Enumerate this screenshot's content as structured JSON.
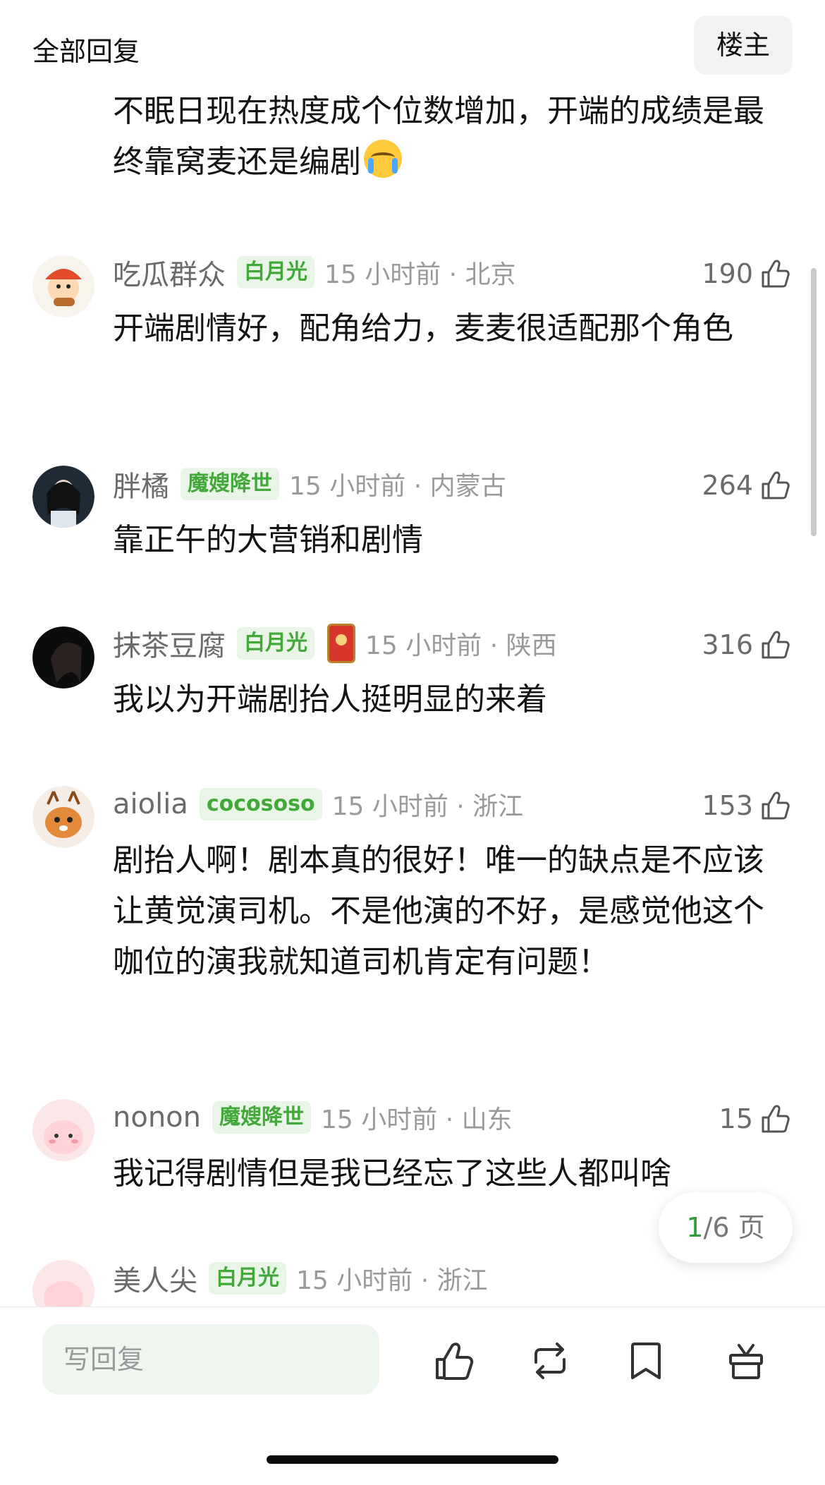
{
  "header": {
    "title": "全部回复",
    "owner_button": "楼主"
  },
  "first_comment_text_part": "不眠日现在热度成个位数增加，开端的成绩是最终靠窝麦还是编剧",
  "comments": [
    {
      "username": "吃瓜群众",
      "badge": "白月光",
      "time": "15 小时前 · 北京",
      "likes": "190",
      "text": "开端剧情好，配角给力，麦麦很适配那个角色"
    },
    {
      "username": "胖橘",
      "badge": "魔嫂降世",
      "time": "15 小时前 · 内蒙古",
      "likes": "264",
      "text": "靠正午的大营销和剧情"
    },
    {
      "username": "抹茶豆腐",
      "badge": "白月光",
      "time": "15 小时前 · 陕西",
      "likes": "316",
      "text": "我以为开端剧抬人挺明显的来着"
    },
    {
      "username": "aiolia",
      "badge": "cocososo",
      "time": "15 小时前 · 浙江",
      "likes": "153",
      "text": "剧抬人啊！剧本真的很好！唯一的缺点是不应该让黄觉演司机。不是他演的不好，是感觉他这个咖位的演我就知道司机肯定有问题！"
    },
    {
      "username": "nonon",
      "badge": "魔嫂降世",
      "time": "15 小时前 · 山东",
      "likes": "15",
      "text": "我记得剧情但是我已经忘了这些人都叫啥"
    },
    {
      "username": "美人尖",
      "badge": "白月光",
      "time": "15 小时前 · 浙江",
      "likes": "",
      "text": ""
    }
  ],
  "pager": {
    "current": "1",
    "rest": "/6 页"
  },
  "bottom_bar": {
    "reply_placeholder": "写回复",
    "icons": [
      "like-icon",
      "repost-icon",
      "bookmark-icon",
      "gift-icon"
    ]
  },
  "colors": {
    "badge_bg": "#e9f6e7",
    "badge_text": "#43a83a",
    "accent_green": "#2e9a3a"
  }
}
